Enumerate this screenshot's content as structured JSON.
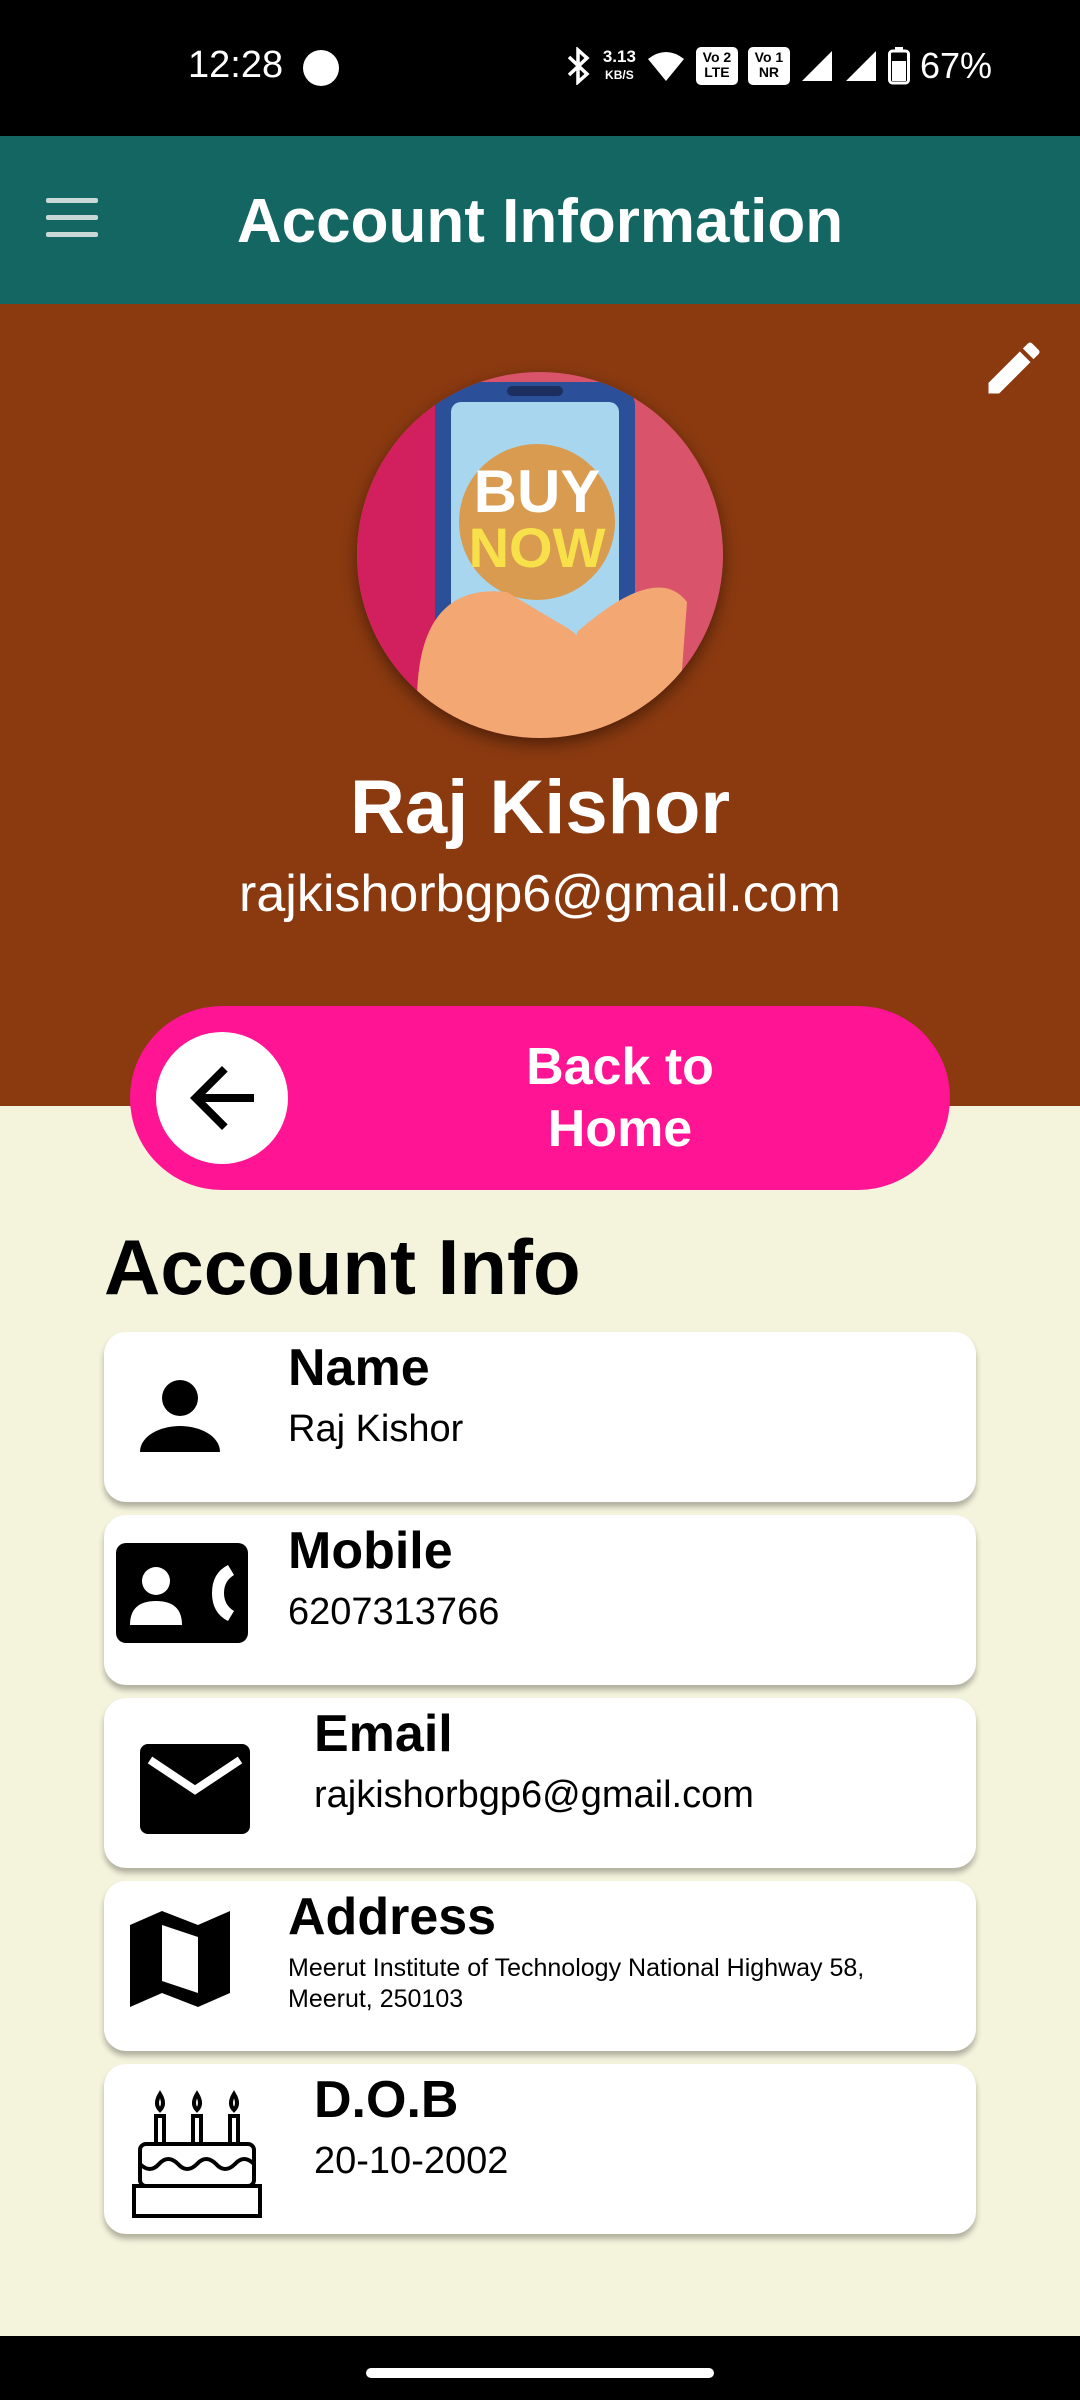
{
  "status_bar": {
    "time": "12:28",
    "net_speed_value": "3.13",
    "net_speed_unit": "KB/S",
    "volte_badge_1": "Vo 2\nLTE",
    "volte_badge_2": "Vo 1\nNR",
    "battery_percent": "67%"
  },
  "app_bar": {
    "title": "Account Information",
    "menu_icon": "hamburger-menu-icon"
  },
  "profile": {
    "name": "Raj Kishor",
    "email": "rajkishorbgp6@gmail.com",
    "avatar_text_1": "BUY",
    "avatar_text_2": "NOW",
    "edit_icon": "pencil-icon"
  },
  "back_button": {
    "label": "Back to\nHome",
    "icon": "arrow-left-icon"
  },
  "section_title": "Account Info",
  "cards": [
    {
      "label": "Name",
      "value": "Raj Kishor",
      "icon": "person-icon"
    },
    {
      "label": "Mobile",
      "value": "6207313766",
      "icon": "contact-phone-icon"
    },
    {
      "label": "Email",
      "value": "rajkishorbgp6@gmail.com",
      "icon": "mail-icon"
    },
    {
      "label": "Address",
      "value": "Meerut Institute of Technology National Highway 58,\nMeerut, 250103",
      "icon": "map-icon"
    },
    {
      "label": "D.O.B",
      "value": "20-10-2002",
      "icon": "birthday-cake-icon"
    }
  ],
  "colors": {
    "app_bar": "#136661",
    "profile_header": "#8b3a10",
    "back_button": "#ff1493",
    "content_bg": "#f4f3dc"
  }
}
